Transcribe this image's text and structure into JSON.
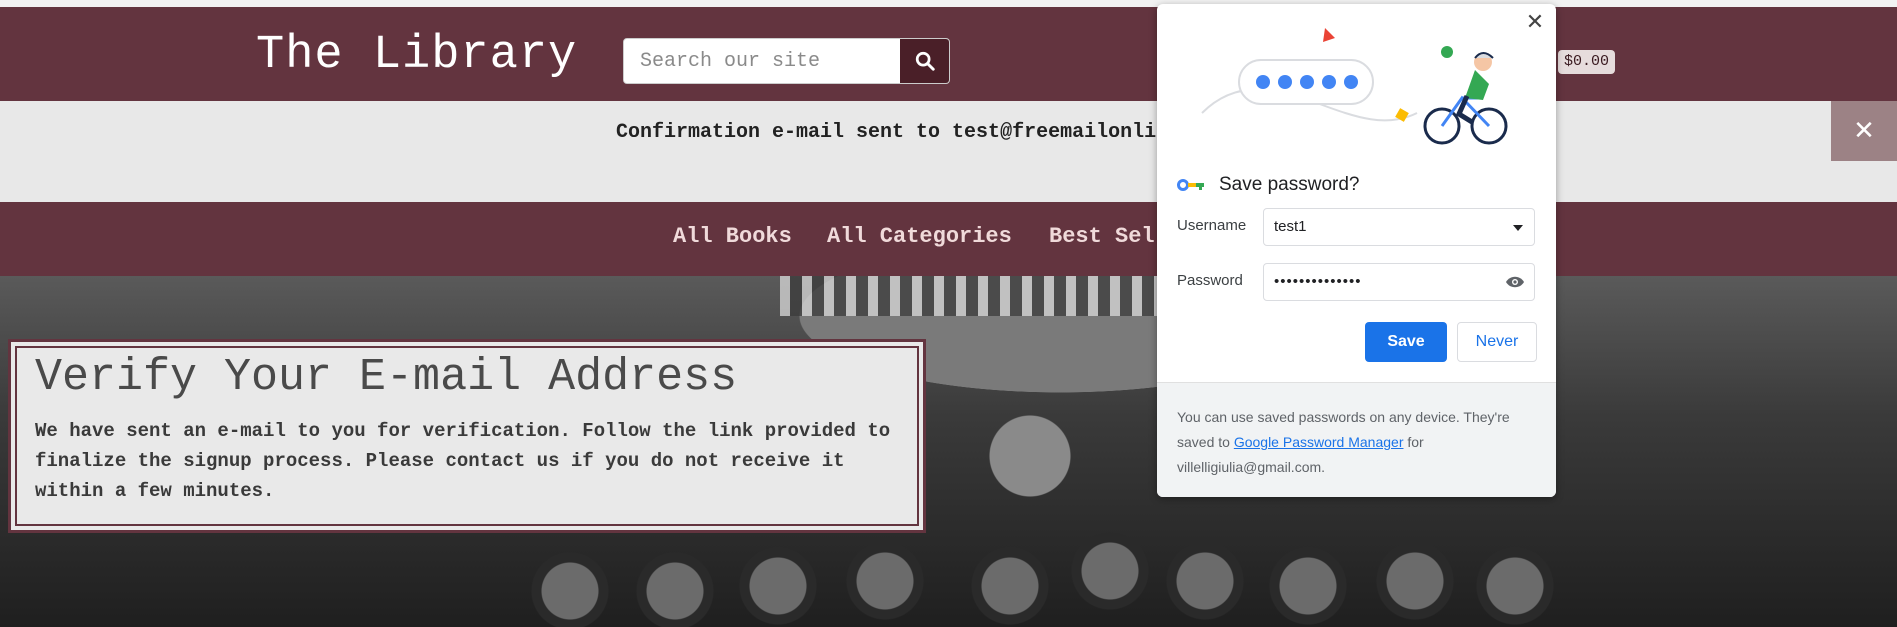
{
  "header": {
    "site_title": "The Library",
    "search_placeholder": "Search our site",
    "search_icon": "search-icon",
    "cart_total": "$0.00"
  },
  "confirmation": {
    "message": "Confirmation e-mail sent to test@freemailonli",
    "close_icon": "close-icon"
  },
  "nav": {
    "items": [
      {
        "label": "All Books"
      },
      {
        "label": "All Categories"
      },
      {
        "label": "Best Sel"
      }
    ]
  },
  "verify": {
    "title": "Verify Your E-mail Address",
    "text": "We have sent an e-mail to you for verification. Follow the link provided to finalize the signup process. Please contact us if you do not receive it within a few minutes."
  },
  "password_popup": {
    "title": "Save password?",
    "username_label": "Username",
    "username_value": "test1",
    "password_label": "Password",
    "password_value": "••••••••••••••",
    "save_label": "Save",
    "never_label": "Never",
    "footer_prefix": "You can use saved passwords on any device. They're saved to ",
    "footer_link": "Google Password Manager",
    "footer_suffix": " for villelligiulia@gmail.com.",
    "icons": [
      "key-icon",
      "close-icon",
      "dropdown-arrow-icon",
      "eye-icon"
    ],
    "colors": {
      "accent": "#1a73e8"
    }
  },
  "colors": {
    "brand": "#63343f",
    "brand_dark": "#4a1f28"
  }
}
